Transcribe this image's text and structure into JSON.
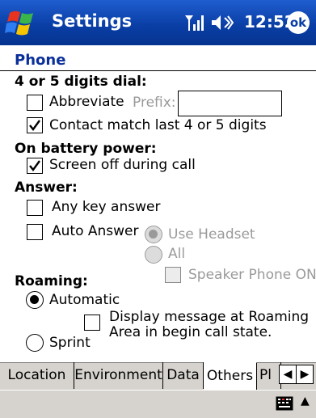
{
  "titlebar": {
    "title": "Settings",
    "time": "12:52",
    "ok_label": "ok",
    "icons": [
      "windows-logo-icon",
      "signal-icon",
      "volume-icon"
    ]
  },
  "page": {
    "title": "Phone"
  },
  "dial": {
    "header": "4 or 5 digits dial:",
    "abbreviate_label": "Abbreviate",
    "prefix_label": "Prefix:",
    "prefix_value": "",
    "abbreviate_checked": false,
    "contact_match_label": "Contact match last 4 or 5 digits",
    "contact_match_checked": true
  },
  "battery": {
    "header": "On battery power:",
    "screen_off_label": "Screen off during call",
    "screen_off_checked": true
  },
  "answer": {
    "header": "Answer:",
    "any_key_label": "Any key answer",
    "any_key_checked": false,
    "auto_answer_label": "Auto Answer",
    "auto_answer_checked": false,
    "use_headset_label": "Use Headset",
    "all_label": "All",
    "speaker_phone_label": "Speaker Phone ON"
  },
  "roaming": {
    "header": "Roaming:",
    "automatic_label": "Automatic",
    "automatic_selected": true,
    "display_message_label_1": "Display message at Roaming",
    "display_message_label_2": "Area in begin call state.",
    "sprint_label": "Sprint"
  },
  "tabs": [
    {
      "label": "Location"
    },
    {
      "label": "Environment"
    },
    {
      "label": "Data"
    },
    {
      "label": "Others"
    },
    {
      "label": "Pl"
    }
  ],
  "colors": {
    "titlebar": "#0a3fa6",
    "page_title": "#0a2f9a",
    "chrome_grey": "#d6d3ce"
  }
}
